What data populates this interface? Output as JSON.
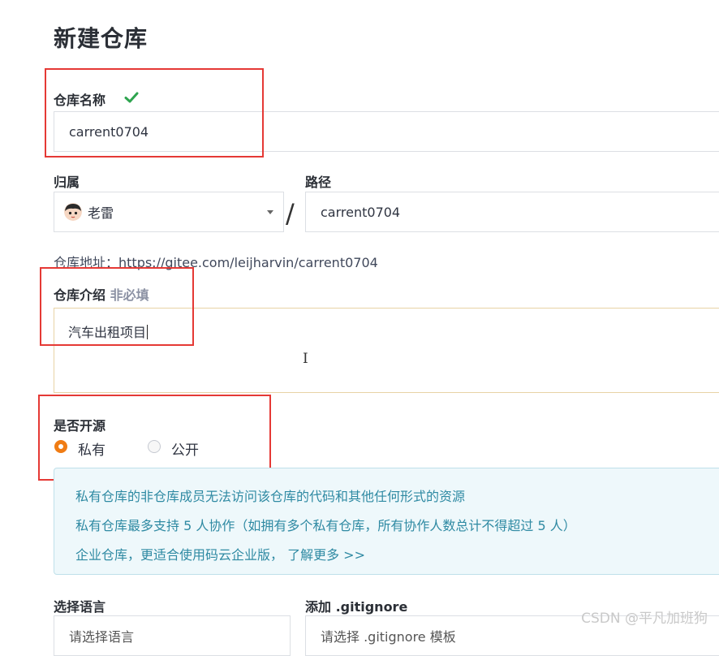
{
  "page_title": "新建仓库",
  "repo_name": {
    "label": "仓库名称",
    "value": "carrent0704",
    "valid_icon": "check-icon"
  },
  "owner": {
    "label": "归属",
    "selected": "老雷",
    "avatar_icon": "avatar"
  },
  "separator": "/",
  "path": {
    "label": "路径",
    "value": "carrent0704"
  },
  "repo_address": "仓库地址：https://gitee.com/leijharvin/carrent0704",
  "intro": {
    "label": "仓库介绍",
    "optional": "非必填",
    "value": "汽车出租项目"
  },
  "visibility": {
    "label": "是否开源",
    "options": [
      {
        "label": "私有",
        "selected": true
      },
      {
        "label": "公开",
        "selected": false
      }
    ]
  },
  "notice": {
    "lines": [
      "私有仓库的非仓库成员无法访问该仓库的代码和其他任何形式的资源",
      "私有仓库最多支持 5 人协作（如拥有多个私有仓库，所有协作人数总计不得超过 5 人）",
      "企业仓库，更适合使用码云企业版， 了解更多 >>"
    ]
  },
  "language": {
    "label": "选择语言",
    "placeholder": "请选择语言"
  },
  "gitignore": {
    "label": "添加 .gitignore",
    "placeholder": "请选择 .gitignore 模板"
  },
  "watermark": "CSDN @平凡加班狗",
  "colors": {
    "accent": "#f07c14",
    "highlight_box": "#e53935",
    "valid": "#2ea44f",
    "notice_text": "#2f8aa3"
  }
}
